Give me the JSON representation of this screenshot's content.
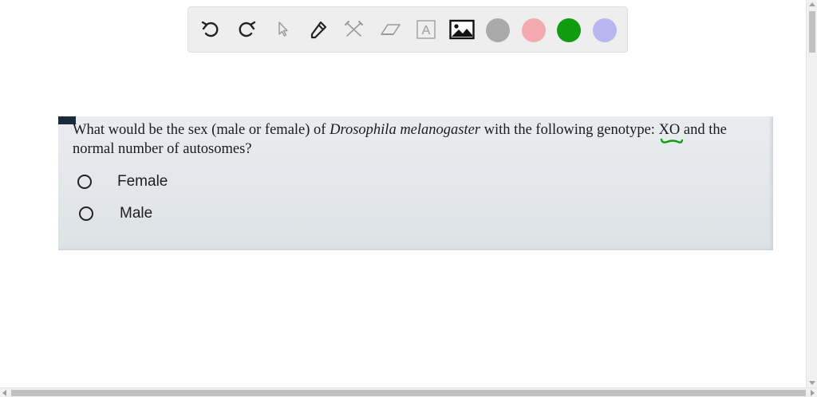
{
  "toolbar": {
    "tools": [
      {
        "icon": "undo-icon"
      },
      {
        "icon": "redo-icon"
      },
      {
        "icon": "select-pointer-icon"
      },
      {
        "icon": "pen-icon"
      },
      {
        "icon": "tools-icon"
      },
      {
        "icon": "eraser-icon"
      },
      {
        "icon": "text-icon",
        "glyph": "A"
      },
      {
        "icon": "image-icon"
      }
    ],
    "colors": [
      "#aaaaaa",
      "#f2aab0",
      "#0f9d0f",
      "#b9b5ee"
    ]
  },
  "question": {
    "text_before": "What would be the sex (male or female) of ",
    "species": "Drosophila melanogaster",
    "text_middle": " with the following genotype: ",
    "genotype": "XO",
    "text_after": " and the normal number of autosomes?",
    "annotation_color": "#0f9d0f"
  },
  "options": [
    {
      "label": "Female"
    },
    {
      "label": "Male"
    }
  ]
}
